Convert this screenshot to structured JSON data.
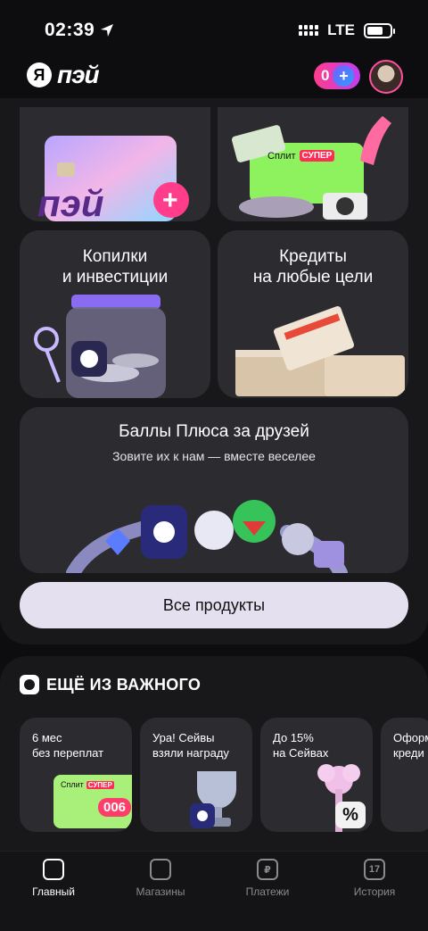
{
  "status": {
    "time": "02:39",
    "network": "LTE"
  },
  "header": {
    "logo_mark": "Я",
    "logo_text": "пэй",
    "points": "0",
    "plus_symbol": "+"
  },
  "products": {
    "card_split_badge": "Сплит",
    "card_split_badge_super": "СУПЕР",
    "piggy": {
      "title_line1": "Копилки",
      "title_line2": "и инвестиции"
    },
    "credit": {
      "title_line1": "Кредиты",
      "title_line2": "на любые цели"
    },
    "friends": {
      "title": "Баллы Плюса за друзей",
      "subtitle": "Зовите их к нам — вместе веселее"
    },
    "all_button": "Все продукты"
  },
  "important": {
    "title": "ЕЩЁ ИЗ ВАЖНОГО",
    "cards": [
      {
        "text": "6 мес\nбез переплат",
        "badge": "Сплит",
        "badge_super": "СУПЕР",
        "number": "006"
      },
      {
        "text": "Ура! Сейвы\nвзяли награду"
      },
      {
        "text": "До 15%\nна Сейвах",
        "percent": "%"
      },
      {
        "text": "Оформ\nкреди"
      }
    ]
  },
  "tabs": [
    {
      "label": "Главный",
      "icon": "wallet-icon",
      "active": true
    },
    {
      "label": "Магазины",
      "icon": "bag-icon",
      "active": false
    },
    {
      "label": "Платежи",
      "icon": "ruble-icon",
      "symbol": "₽",
      "active": false
    },
    {
      "label": "История",
      "icon": "calendar-icon",
      "day": "17",
      "active": false
    }
  ],
  "colors": {
    "accent_pink": "#ff3d8b",
    "accent_purple": "#7a5cff",
    "button_bg": "#e4e0f0"
  }
}
